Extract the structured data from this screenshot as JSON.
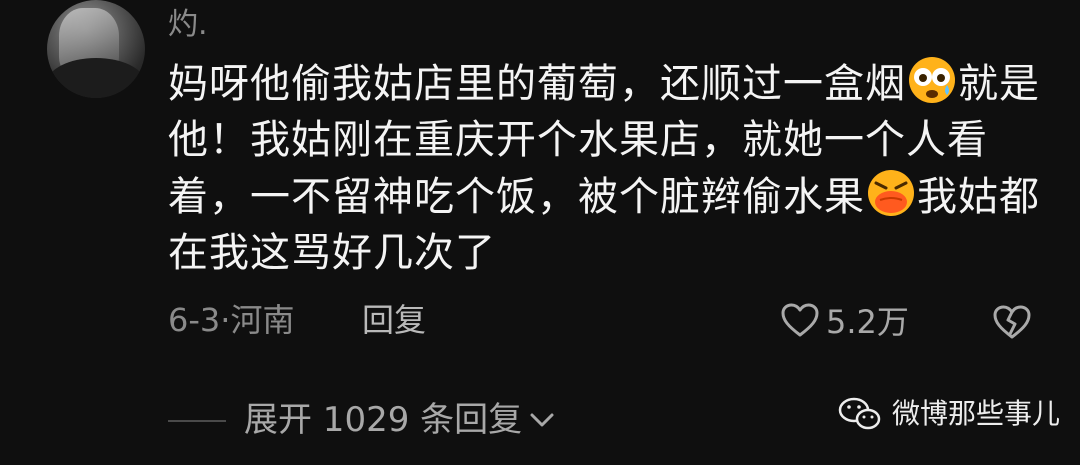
{
  "comment": {
    "username": "灼.",
    "text_segments": [
      "妈呀他偷我姑店里的葡萄，还顺过一盒烟",
      "就是他！我姑刚在重庆开个水果店，就她一个人看着，一不留神吃个饭，被个脏辫偷水果",
      "我姑都在我这骂好几次了"
    ],
    "emojis": [
      "shocked-crying-emoji",
      "angry-face-emoji"
    ],
    "date": "6-3·河南",
    "reply_label": "回复",
    "like_count": "5.2万",
    "expand_label": "展开 1029 条回复"
  },
  "watermark": {
    "label": "微博那些事儿",
    "icon": "wechat-icon"
  },
  "colors": {
    "background": "#0f0f0f",
    "text": "#f4f4f4",
    "muted": "#8a8a8a",
    "emoji": "#ffb21a"
  }
}
